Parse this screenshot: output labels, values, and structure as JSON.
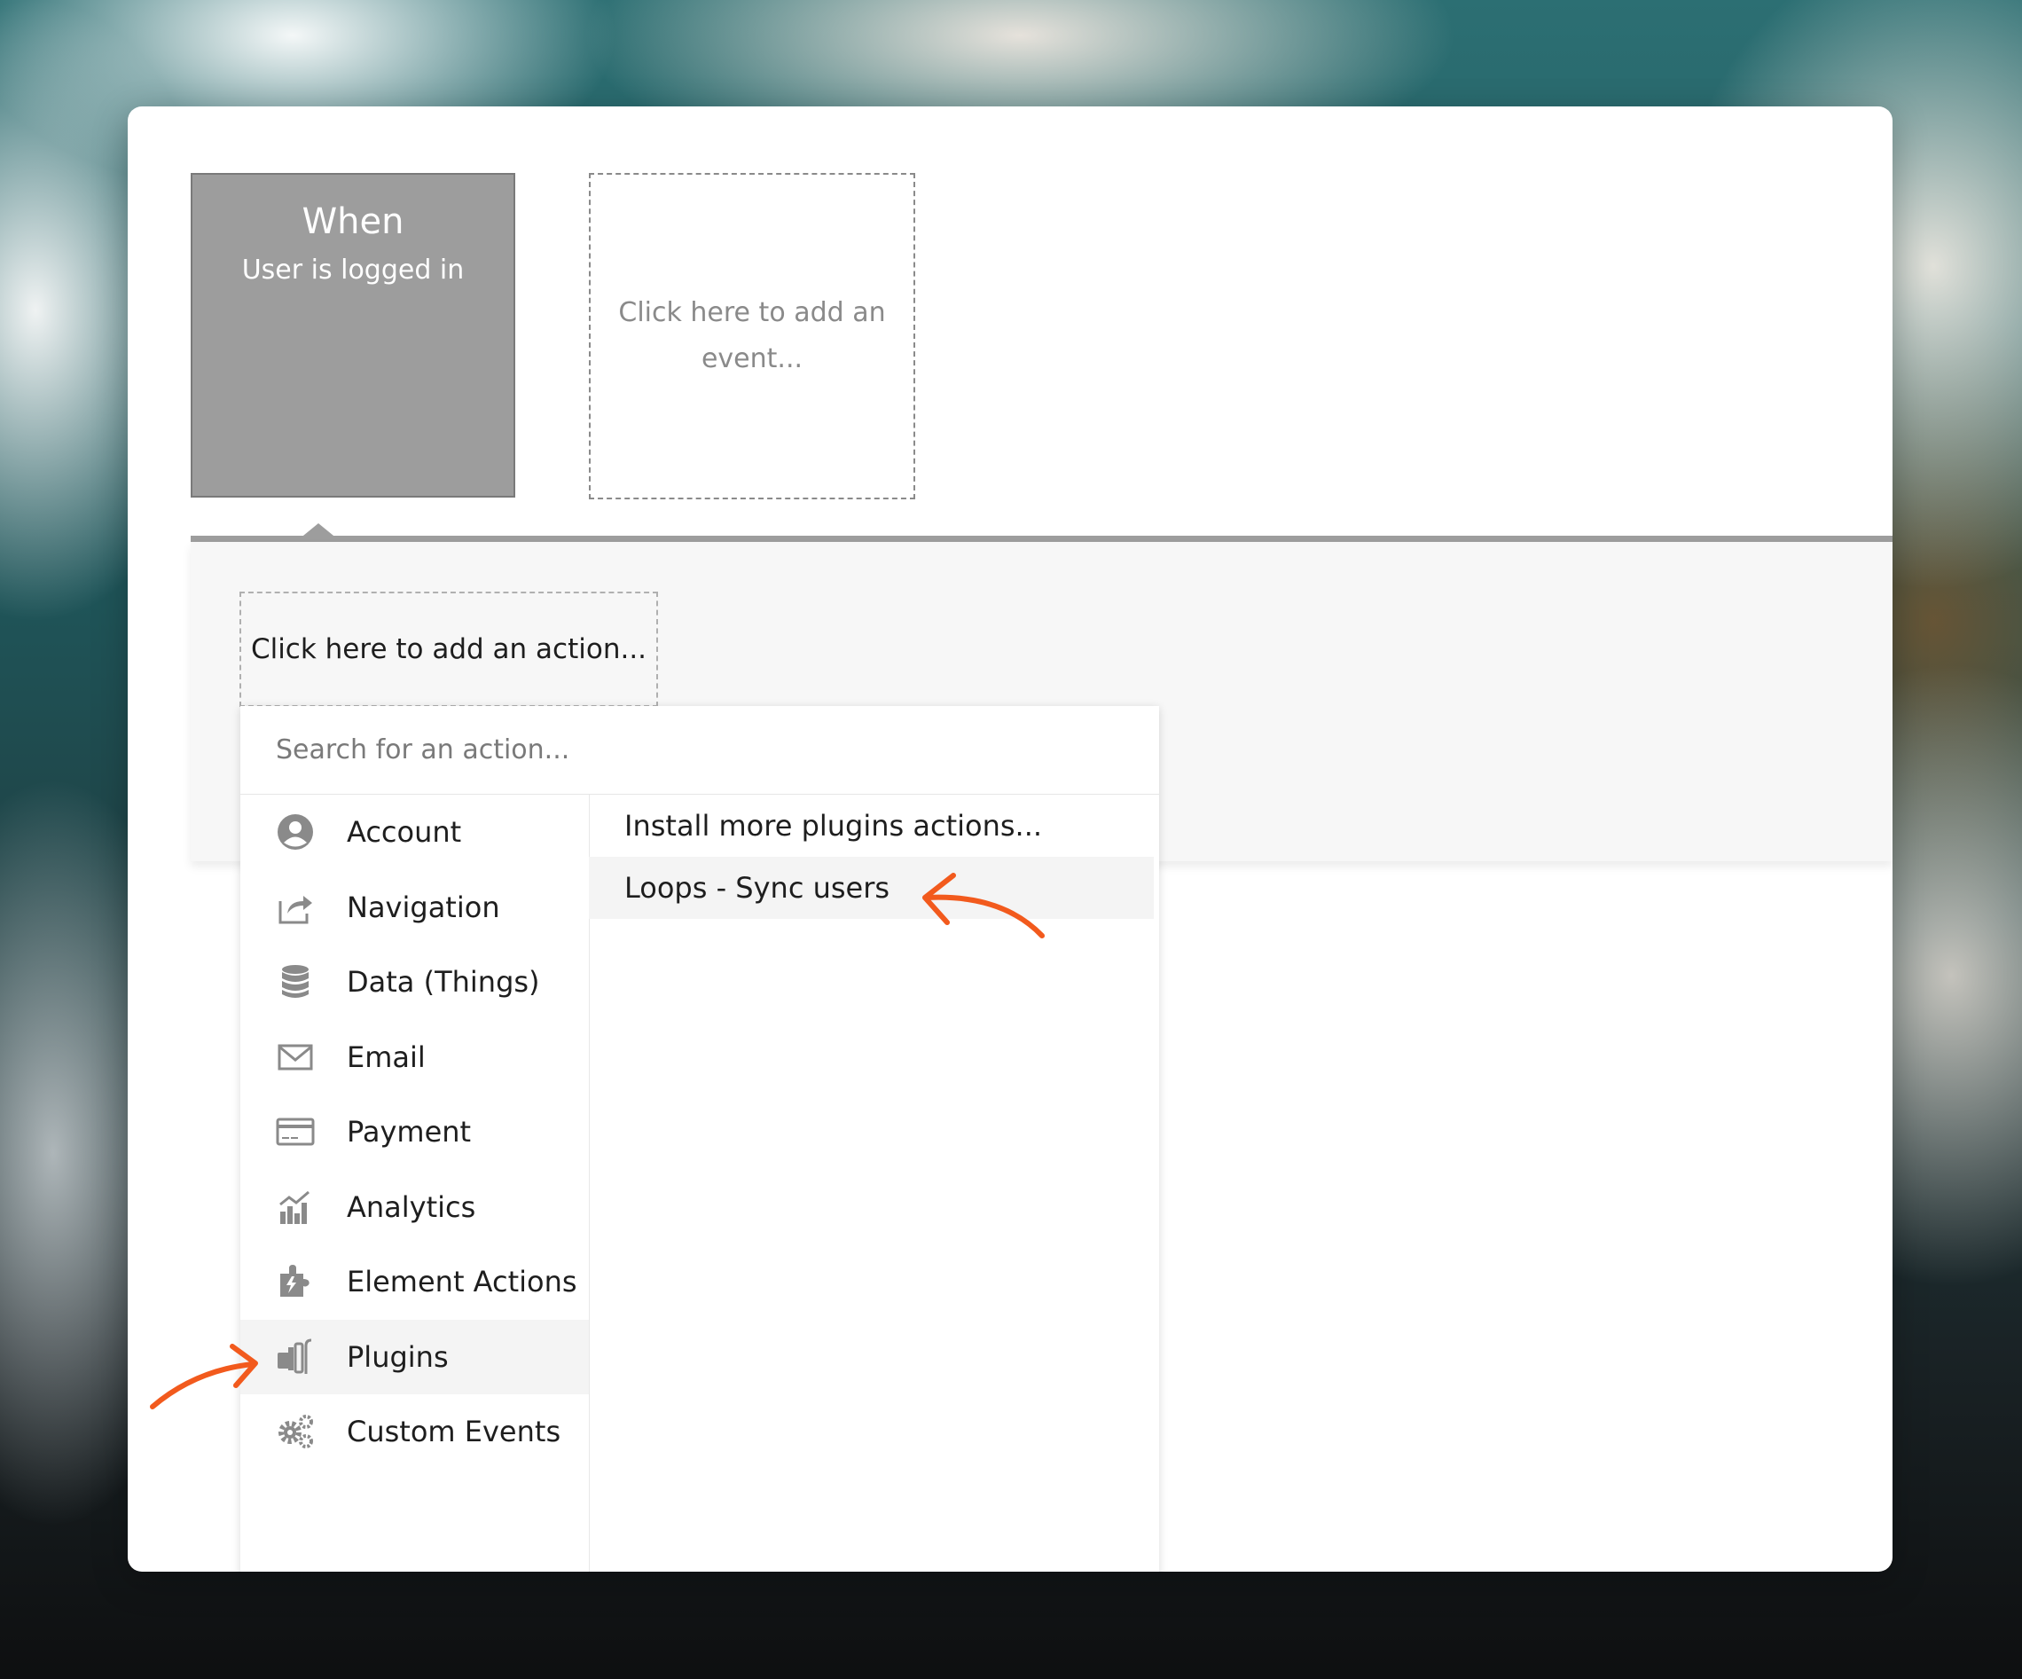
{
  "event_card": {
    "title": "When",
    "condition": "User is logged in"
  },
  "add_event": {
    "label": "Click here to add an event..."
  },
  "add_action": {
    "label": "Click here to add an action..."
  },
  "dropdown": {
    "search_placeholder": "Search for an action...",
    "categories": [
      {
        "label": "Account",
        "icon": "account-icon"
      },
      {
        "label": "Navigation",
        "icon": "navigation-icon"
      },
      {
        "label": "Data (Things)",
        "icon": "database-icon"
      },
      {
        "label": "Email",
        "icon": "email-icon"
      },
      {
        "label": "Payment",
        "icon": "credit-card-icon"
      },
      {
        "label": "Analytics",
        "icon": "analytics-icon"
      },
      {
        "label": "Element Actions",
        "icon": "element-actions-icon"
      },
      {
        "label": "Plugins",
        "icon": "plugins-icon",
        "selected": true
      },
      {
        "label": "Custom Events",
        "icon": "gears-icon"
      }
    ],
    "plugin_actions": [
      {
        "label": "Install more plugins actions..."
      },
      {
        "label": "Loops - Sync users",
        "highlighted": true
      }
    ]
  },
  "colors": {
    "event_card_bg": "#9d9d9d",
    "annotation_arrow": "#f25a1d",
    "icon_gray": "#8a8a8a"
  }
}
